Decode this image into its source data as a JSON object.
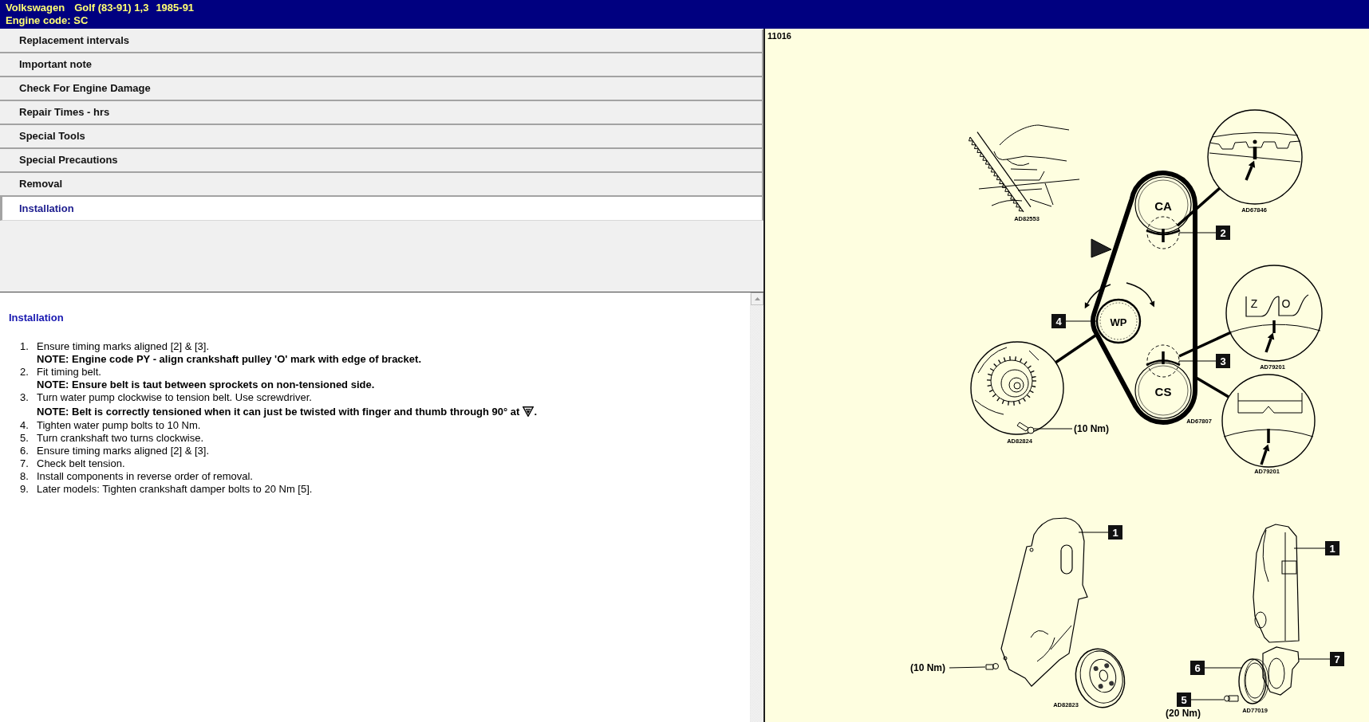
{
  "header": {
    "make": "Volkswagen",
    "model": "Golf (83-91) 1,3",
    "years": "1985-91",
    "engine_code": "Engine code: SC"
  },
  "topics": [
    {
      "label": "Replacement intervals",
      "selected": false
    },
    {
      "label": "Important note",
      "selected": false
    },
    {
      "label": "Check For Engine Damage",
      "selected": false
    },
    {
      "label": "Repair Times - hrs",
      "selected": false
    },
    {
      "label": "Special Tools",
      "selected": false
    },
    {
      "label": "Special Precautions",
      "selected": false
    },
    {
      "label": "Removal",
      "selected": false
    },
    {
      "label": "Installation",
      "selected": true
    }
  ],
  "content": {
    "heading": "Installation",
    "steps": [
      {
        "number": "1.",
        "kind": "note",
        "text": "Ensure timing marks aligned [2] & [3].",
        "note": "NOTE: Engine code PY - align crankshaft pulley 'O' mark with edge of bracket."
      },
      {
        "number": "2.",
        "kind": "note",
        "text": "Fit timing belt.",
        "note": "NOTE: Ensure belt is taut between sprockets on non-tensioned side."
      },
      {
        "number": "3.",
        "kind": "marked",
        "text": "Turn water pump clockwise to tension belt. Use screwdriver.",
        "note": "NOTE: Belt is correctly tensioned when it can just be twisted with finger and thumb through 90° at",
        "note_end": "."
      },
      {
        "number": "4.",
        "kind": "plain",
        "text": "Tighten water pump bolts to 10 Nm."
      },
      {
        "number": "5.",
        "kind": "plain",
        "text": "Turn crankshaft two turns clockwise."
      },
      {
        "number": "6.",
        "kind": "plain",
        "text": "Ensure timing marks aligned [2] & [3]."
      },
      {
        "number": "7.",
        "kind": "plain",
        "text": "Check belt tension."
      },
      {
        "number": "8.",
        "kind": "plain",
        "text": "Install components in reverse order of removal."
      },
      {
        "number": "9.",
        "kind": "plain",
        "text": "Later models: Tighten crankshaft damper bolts to 20 Nm [5]."
      }
    ]
  },
  "diagram": {
    "number": "11016",
    "belt_layout": {
      "pulleys": [
        "CA",
        "WP",
        "CS"
      ],
      "ref": "AD67807"
    },
    "callouts": [
      "2",
      "4",
      "3"
    ],
    "details": [
      {
        "kind": "hand",
        "ref": "AD82553"
      },
      {
        "kind": "camshaft",
        "ref": "AD67846"
      },
      {
        "kind": "scale",
        "marks": [
          "Z",
          "O"
        ],
        "ref": "AD79201"
      },
      {
        "kind": "crankshaft",
        "ref": "AD79201"
      },
      {
        "kind": "pump",
        "torque": "(10 Nm)",
        "ref": "AD82824"
      }
    ],
    "early_cover": {
      "callout": "1",
      "torque": "(10 Nm)",
      "ref": "AD82823"
    },
    "late_cover": {
      "callouts": [
        "1",
        "7",
        "6",
        "5"
      ],
      "torque": "(20 Nm)",
      "ref": "AD77019"
    }
  }
}
